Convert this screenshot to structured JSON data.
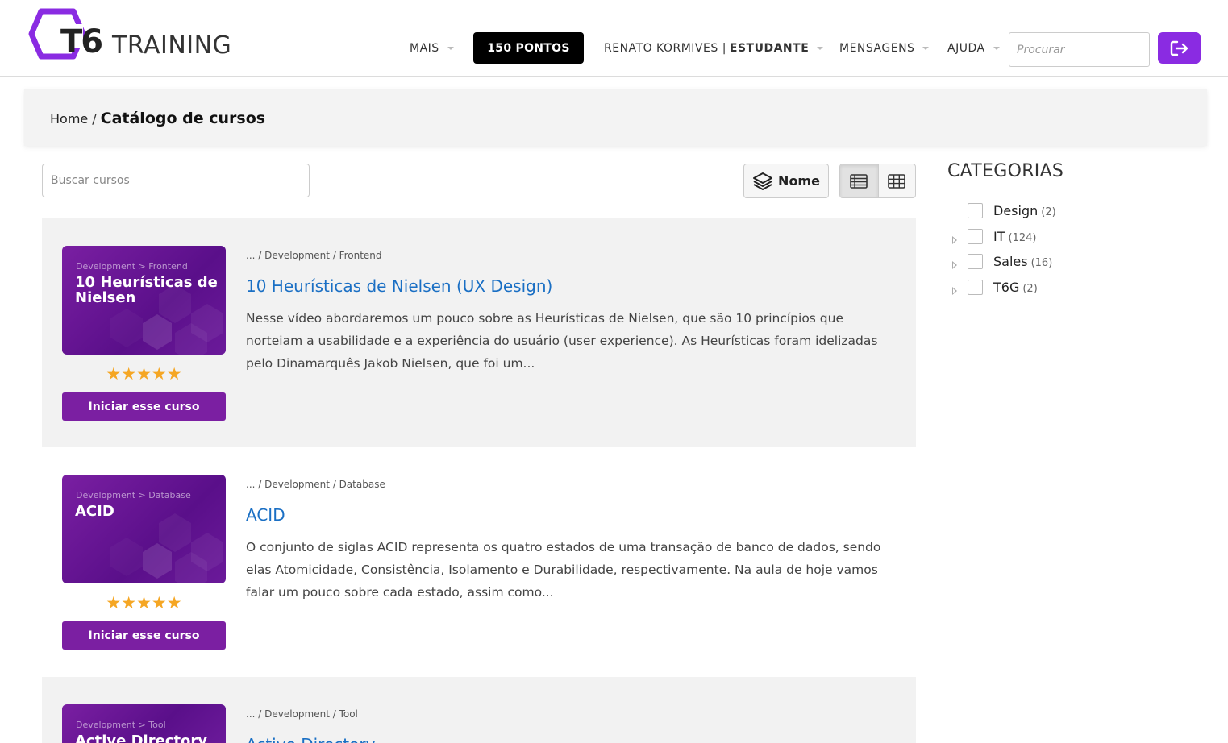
{
  "header": {
    "logo_mark": "T6",
    "logo_text": "TRAINING",
    "nav": {
      "more": "MAIS",
      "points": "150 PONTOS",
      "user_name": "RENATO KORMIVES |",
      "user_role": "ESTUDANTE",
      "messages": "MENSAGENS",
      "help": "AJUDA"
    },
    "search_placeholder": "Procurar",
    "accent_color": "#8a2be2"
  },
  "breadcrumb": {
    "home": "Home",
    "separator": "/",
    "current": "Catálogo de cursos"
  },
  "toolbar": {
    "search_placeholder": "Buscar cursos",
    "sort_label": "Nome"
  },
  "courses": [
    {
      "thumb_category": "Development > Frontend",
      "thumb_title": "10 Heurísticas de Nielsen",
      "rating": "★★★★★",
      "rating_value": 5,
      "button_label": "Iniciar esse curso",
      "path": "... / Development / Frontend",
      "title": "10 Heurísticas de Nielsen (UX Design)",
      "description": "Nesse vídeo abordaremos um pouco sobre as Heurísticas de Nielsen, que são 10 princípios que norteiam a usabilidade e a experiência do usuário (user experience). As Heurísticas foram idelizadas pelo Dinamarquês Jakob Nielsen, que foi um..."
    },
    {
      "thumb_category": "Development > Database",
      "thumb_title": "ACID",
      "rating": "★★★★★",
      "rating_value": 5,
      "button_label": "Iniciar esse curso",
      "path": "... / Development / Database",
      "title": "ACID",
      "description": "O conjunto de siglas ACID representa os quatro estados de uma transação de banco de dados, sendo elas Atomicidade, Consistência, Isolamento e Durabilidade, respectivamente. Na aula de hoje vamos falar um pouco sobre cada estado, assim como..."
    },
    {
      "thumb_category": "Development > Tool",
      "thumb_title": "Active Directory",
      "path": "... / Development / Tool",
      "title": "Active Directory"
    }
  ],
  "categories": {
    "title": "CATEGORIAS",
    "items": [
      {
        "label": "Design",
        "count": "(2)",
        "expandable": false
      },
      {
        "label": "IT",
        "count": "(124)",
        "expandable": true
      },
      {
        "label": "Sales",
        "count": "(16)",
        "expandable": true
      },
      {
        "label": "T6G",
        "count": "(2)",
        "expandable": true
      }
    ]
  }
}
